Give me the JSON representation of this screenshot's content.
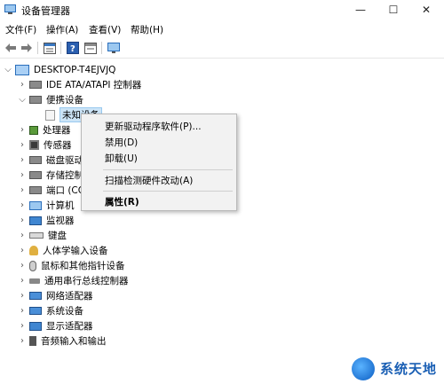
{
  "window": {
    "title": "设备管理器",
    "controls": {
      "minimize": "—",
      "maximize": "☐",
      "close": "✕"
    }
  },
  "menubar": {
    "items": [
      "文件(F)",
      "操作(A)",
      "查看(V)",
      "帮助(H)"
    ]
  },
  "toolbar": {
    "buttons": [
      "back-icon",
      "forward-icon",
      "properties-icon",
      "help-icon",
      "refresh-icon",
      "monitor-icon"
    ]
  },
  "tree": {
    "root": "DESKTOP-T4EJVJQ",
    "nodes": [
      {
        "label": "IDE ATA/ATAPI 控制器",
        "icon": "ide-controller-icon",
        "expanded": false
      },
      {
        "label": "便携设备",
        "icon": "portable-devices-icon",
        "expanded": true
      },
      {
        "label": "未知设备",
        "icon": "unknown-device-icon",
        "child": true,
        "selected": true
      },
      {
        "label": "处理器",
        "icon": "processor-icon",
        "expanded": false
      },
      {
        "label": "传感器",
        "icon": "sensor-icon",
        "expanded": false
      },
      {
        "label": "磁盘驱动器",
        "icon": "disk-drive-icon",
        "expanded": false
      },
      {
        "label": "存储控制器",
        "icon": "storage-controller-icon",
        "expanded": false
      },
      {
        "label": "端口 (COM 和 LPT)",
        "icon": "port-icon",
        "expanded": false
      },
      {
        "label": "计算机",
        "icon": "computer-icon",
        "expanded": false
      },
      {
        "label": "监视器",
        "icon": "monitor-icon",
        "expanded": false
      },
      {
        "label": "键盘",
        "icon": "keyboard-icon",
        "expanded": false
      },
      {
        "label": "人体学输入设备",
        "icon": "hid-icon",
        "expanded": false
      },
      {
        "label": "鼠标和其他指针设备",
        "icon": "mouse-icon",
        "expanded": false
      },
      {
        "label": "通用串行总线控制器",
        "icon": "usb-icon",
        "expanded": false
      },
      {
        "label": "网络适配器",
        "icon": "network-adapter-icon",
        "expanded": false
      },
      {
        "label": "系统设备",
        "icon": "system-devices-icon",
        "expanded": false
      },
      {
        "label": "显示适配器",
        "icon": "display-adapter-icon",
        "expanded": false
      },
      {
        "label": "音频输入和输出",
        "icon": "audio-icon",
        "expanded": false
      }
    ]
  },
  "context_menu": {
    "items": [
      {
        "label": "更新驱动程序软件(P)...",
        "bold": false
      },
      {
        "label": "禁用(D)",
        "bold": false
      },
      {
        "label": "卸载(U)",
        "bold": false
      },
      {
        "label": "扫描检测硬件改动(A)",
        "bold": false
      },
      {
        "label": "属性(R)",
        "bold": true
      }
    ]
  },
  "watermark": {
    "text": "系统天地"
  }
}
